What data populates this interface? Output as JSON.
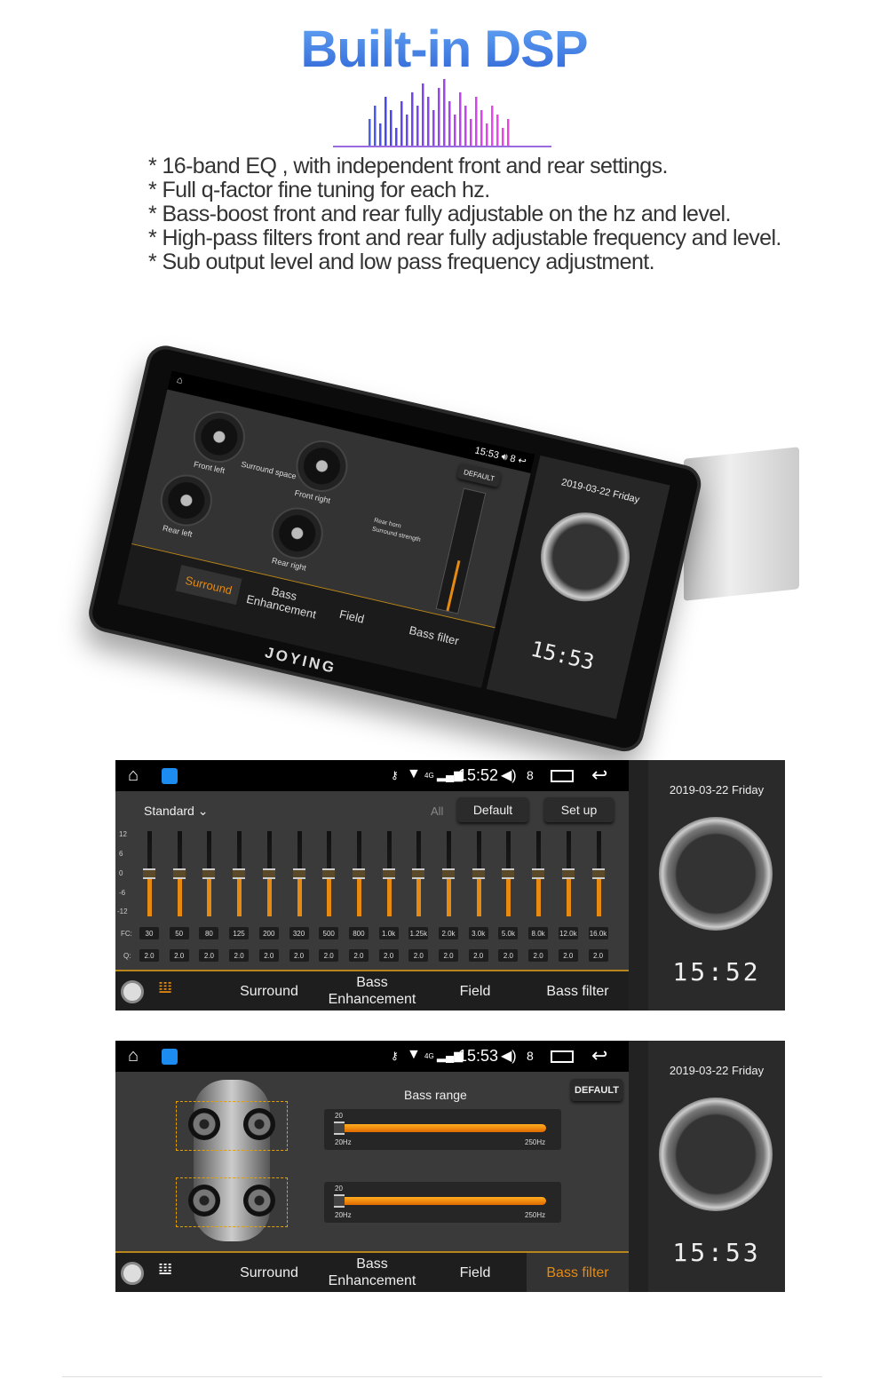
{
  "title": "Built-in DSP",
  "features": [
    "* 16-band EQ , with independent front and rear settings.",
    "* Full q-factor fine tuning for each hz.",
    "* Bass-boost front and rear fully adjustable on the hz and level.",
    "* High-pass filters front and rear fully adjustable frequency and level.",
    "* Sub output level and  low pass frequency adjustment."
  ],
  "colors": {
    "accent": "#e68a12",
    "title": "#3f7fe0"
  },
  "device": {
    "brand": "JOYING",
    "status": {
      "time": "15:53",
      "volume": "8"
    },
    "gauges": [
      "Front left",
      "Front right",
      "Rear left",
      "Rear right"
    ],
    "surround_space": "Surround space",
    "rear_horn": "Rear horn",
    "surround_strength": "Surround strength",
    "default_label": "DEFAULT",
    "nav": [
      "Surround",
      "Bass Enhancement",
      "Field",
      "Bass filter"
    ],
    "active_nav": "Surround",
    "date": "2019-03-22 Friday",
    "clock": "15:53"
  },
  "eq_screen": {
    "status": {
      "time": "15:52",
      "volume": "8",
      "network": "4G"
    },
    "preset": "Standard",
    "all_label": "All",
    "default_label": "Default",
    "setup_label": "Set up",
    "y_ticks": [
      "12",
      "6",
      "0",
      "-6",
      "-12"
    ],
    "fc_label": "FC:",
    "q_label": "Q:",
    "bands": [
      {
        "fc": "30",
        "q": "2.0",
        "gain": 0
      },
      {
        "fc": "50",
        "q": "2.0",
        "gain": 0
      },
      {
        "fc": "80",
        "q": "2.0",
        "gain": 0
      },
      {
        "fc": "125",
        "q": "2.0",
        "gain": 0
      },
      {
        "fc": "200",
        "q": "2.0",
        "gain": 0
      },
      {
        "fc": "320",
        "q": "2.0",
        "gain": 0
      },
      {
        "fc": "500",
        "q": "2.0",
        "gain": 0
      },
      {
        "fc": "800",
        "q": "2.0",
        "gain": 0
      },
      {
        "fc": "1.0k",
        "q": "2.0",
        "gain": 0
      },
      {
        "fc": "1.25k",
        "q": "2.0",
        "gain": 0
      },
      {
        "fc": "2.0k",
        "q": "2.0",
        "gain": 0
      },
      {
        "fc": "3.0k",
        "q": "2.0",
        "gain": 0
      },
      {
        "fc": "5.0k",
        "q": "2.0",
        "gain": 0
      },
      {
        "fc": "8.0k",
        "q": "2.0",
        "gain": 0
      },
      {
        "fc": "12.0k",
        "q": "2.0",
        "gain": 0
      },
      {
        "fc": "16.0k",
        "q": "2.0",
        "gain": 0
      }
    ],
    "nav": [
      "Surround",
      "Bass\nEnhancement",
      "Field",
      "Bass filter"
    ],
    "date": "2019-03-22 Friday",
    "clock": "15:52"
  },
  "bass_screen": {
    "status": {
      "time": "15:53",
      "volume": "8",
      "network": "4G"
    },
    "heading": "Bass range",
    "default_label": "DEFAULT",
    "sliders": [
      {
        "value": "20",
        "min": "20Hz",
        "max": "250Hz"
      },
      {
        "value": "20",
        "min": "20Hz",
        "max": "250Hz"
      }
    ],
    "nav": [
      "Surround",
      "Bass\nEnhancement",
      "Field",
      "Bass filter"
    ],
    "active_nav": "Bass filter",
    "date": "2019-03-22 Friday",
    "clock": "15:53"
  }
}
